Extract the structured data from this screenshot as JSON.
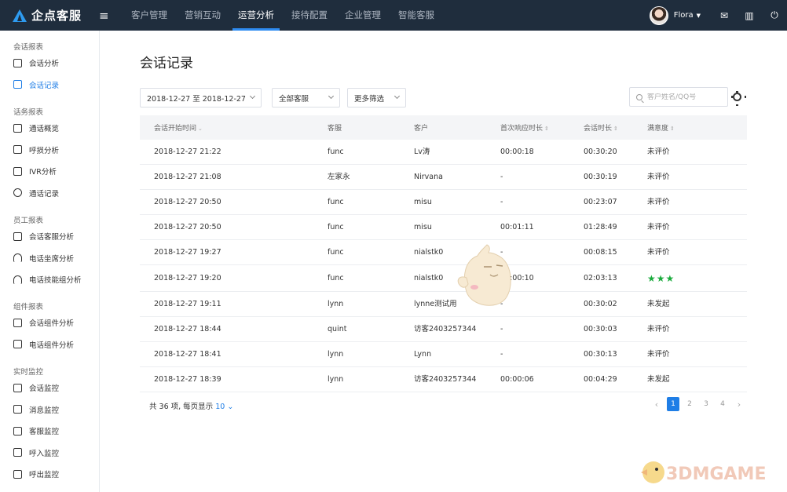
{
  "app": {
    "title": "企点客服",
    "accent": "#1f7ee6",
    "topbar_bg": "#1f2d3d"
  },
  "topnav": [
    {
      "label": "客户管理"
    },
    {
      "label": "营销互动"
    },
    {
      "label": "运营分析",
      "active": true
    },
    {
      "label": "接待配置"
    },
    {
      "label": "企业管理"
    },
    {
      "label": "智能客服"
    }
  ],
  "user": {
    "name": "Flora"
  },
  "top_icons": [
    "mail-icon",
    "book-icon",
    "logout-icon"
  ],
  "sidebar": {
    "groups": [
      {
        "title": "会话报表",
        "items": [
          {
            "label": "会话分析",
            "icon": "chart-icon"
          },
          {
            "label": "会话记录",
            "icon": "record-icon",
            "active": true
          }
        ]
      },
      {
        "title": "话务报表",
        "items": [
          {
            "label": "通话概览",
            "icon": "overview-icon"
          },
          {
            "label": "呼损分析",
            "icon": "phone-icon"
          },
          {
            "label": "IVR分析",
            "icon": "grid-icon"
          },
          {
            "label": "通话记录",
            "icon": "clock-icon"
          }
        ]
      },
      {
        "title": "员工报表",
        "items": [
          {
            "label": "会话客服分析",
            "icon": "chat-icon"
          },
          {
            "label": "电话坐席分析",
            "icon": "headset-icon"
          },
          {
            "label": "电话技能组分析",
            "icon": "headset-icon"
          }
        ]
      },
      {
        "title": "组件报表",
        "items": [
          {
            "label": "会话组件分析",
            "icon": "widget-icon"
          },
          {
            "label": "电话组件分析",
            "icon": "widget-icon"
          }
        ]
      },
      {
        "title": "实时监控",
        "items": [
          {
            "label": "会话监控",
            "icon": "monitor-icon"
          },
          {
            "label": "消息监控",
            "icon": "message-icon"
          },
          {
            "label": "客服监控",
            "icon": "user-card-icon"
          },
          {
            "label": "呼入监控",
            "icon": "call-in-icon"
          },
          {
            "label": "呼出监控",
            "icon": "call-out-icon"
          }
        ]
      }
    ]
  },
  "page": {
    "title": "会话记录"
  },
  "filters": {
    "date_range": "2018-12-27 至 2018-12-27",
    "agent": "全部客服",
    "more": "更多筛选",
    "search_placeholder": "客户姓名/QQ号"
  },
  "table": {
    "columns": [
      "会话开始时间",
      "客服",
      "客户",
      "首次响应时长",
      "会话时长",
      "满意度"
    ],
    "rows": [
      [
        "2018-12-27 21:22",
        "func",
        "Lv涛",
        "00:00:18",
        "00:30:20",
        "未评价"
      ],
      [
        "2018-12-27 21:08",
        "左家永",
        "Nirvana",
        "-",
        "00:30:19",
        "未评价"
      ],
      [
        "2018-12-27 20:50",
        "func",
        "misu",
        "-",
        "00:23:07",
        "未评价"
      ],
      [
        "2018-12-27 20:50",
        "func",
        "misu",
        "00:01:11",
        "01:28:49",
        "未评价"
      ],
      [
        "2018-12-27 19:27",
        "func",
        "nialstk0",
        "-",
        "00:08:15",
        "未评价"
      ],
      [
        "2018-12-27 19:20",
        "func",
        "nialstk0",
        "00:00:10",
        "02:03:13",
        "★★★"
      ],
      [
        "2018-12-27 19:11",
        "lynn",
        "lynne测试用",
        "-",
        "00:30:02",
        "未发起"
      ],
      [
        "2018-12-27 18:44",
        "quint",
        "访客2403257344",
        "-",
        "00:30:03",
        "未评价"
      ],
      [
        "2018-12-27 18:41",
        "lynn",
        "Lynn",
        "-",
        "00:30:13",
        "未评价"
      ],
      [
        "2018-12-27 18:39",
        "lynn",
        "访客2403257344",
        "00:00:06",
        "00:04:29",
        "未发起"
      ]
    ]
  },
  "footer": {
    "total_prefix": "共 36 项, 每页显示",
    "page_size": "10",
    "pages": [
      "1",
      "2",
      "3",
      "4"
    ],
    "current_page": "1"
  },
  "watermark": "3DMGAME"
}
